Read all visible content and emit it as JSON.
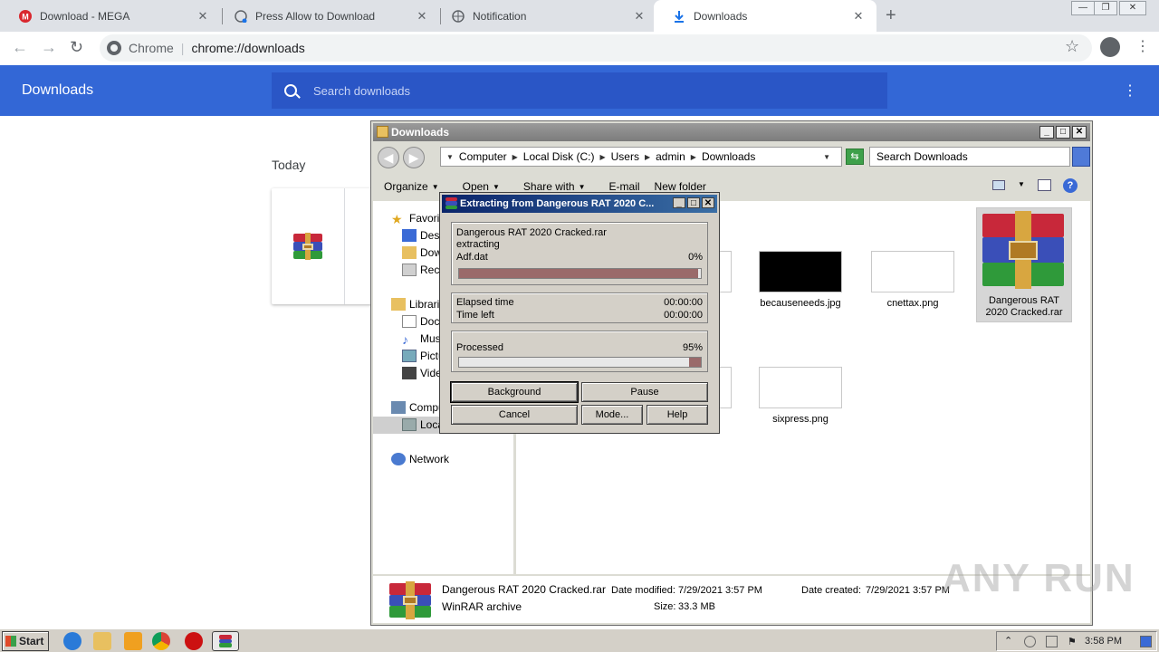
{
  "browser": {
    "tabs": [
      {
        "title": "Download - MEGA",
        "icon": "mega-icon"
      },
      {
        "title": "Press Allow to Download",
        "icon": "globe-icon"
      },
      {
        "title": "Notification",
        "icon": "globe-icon"
      },
      {
        "title": "Downloads",
        "icon": "download-icon"
      }
    ],
    "active_tab": 3,
    "omnibox": {
      "scheme": "Chrome",
      "url": "chrome://downloads"
    }
  },
  "downloads_page": {
    "title": "Downloads",
    "search_placeholder": "Search downloads",
    "section_label": "Today"
  },
  "explorer": {
    "title": "Downloads",
    "breadcrumb": [
      "Computer",
      "Local Disk (C:)",
      "Users",
      "admin",
      "Downloads"
    ],
    "search_placeholder": "Search Downloads",
    "toolbar": {
      "organize": "Organize",
      "open": "Open",
      "share_with": "Share with",
      "email": "E-mail",
      "new_folder": "New folder"
    },
    "nav": {
      "favorites": "Favori",
      "desktop": "Desk",
      "downloads": "Dow",
      "recent": "Rece",
      "libraries": "Librarie",
      "documents": "Docu",
      "music": "Musi",
      "pictures": "Pictu",
      "videos": "Vide",
      "computer": "Compu",
      "local_disk": "Loca",
      "network": "Network"
    },
    "files": [
      {
        "name": "becauseneeds.jpg",
        "thumb_color": "#000000"
      },
      {
        "name": "cnettax.png",
        "thumb_color": "#ffffff"
      },
      {
        "name": "Dangerous RAT 2020 Cracked.rar",
        "thumb_color": "winrar"
      },
      {
        "name": "sixpress.png",
        "thumb_color": "#ffffff"
      }
    ],
    "details": {
      "name": "Dangerous RAT 2020 Cracked.rar",
      "type": "WinRAR archive",
      "modified_label": "Date modified:",
      "modified": "7/29/2021 3:57 PM",
      "size_label": "Size:",
      "size": "33.3 MB",
      "created_label": "Date created:",
      "created": "7/29/2021 3:57 PM"
    }
  },
  "winrar": {
    "title": "Extracting from Dangerous RAT 2020 C...",
    "archive": "Dangerous RAT 2020 Cracked.rar",
    "action": "extracting",
    "current_file": "Adf.dat",
    "file_progress": "0%",
    "file_progress_value": 0.99,
    "elapsed_label": "Elapsed time",
    "elapsed": "00:00:00",
    "left_label": "Time left",
    "left": "00:00:00",
    "processed_label": "Processed",
    "processed": "95%",
    "processed_value": 0.95,
    "buttons": {
      "background": "Background",
      "pause": "Pause",
      "cancel": "Cancel",
      "mode": "Mode...",
      "help": "Help"
    }
  },
  "taskbar": {
    "start": "Start",
    "clock": "3:58 PM"
  },
  "watermark": "ANY RUN",
  "colors": {
    "chrome_blue": "#3367d6",
    "rar_title": "#0a246a",
    "progress_fill": "#9a6a6a"
  }
}
